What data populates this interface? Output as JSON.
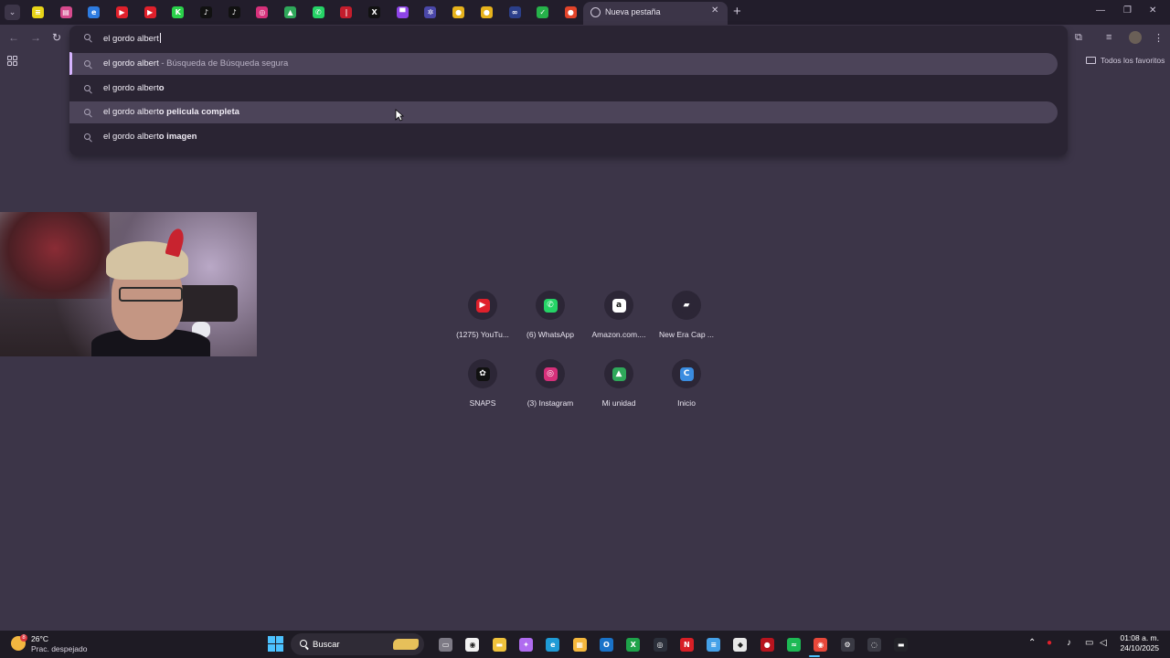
{
  "tabs": {
    "pinned": [
      {
        "name": "tab-pinned-1",
        "color": "#e8d418",
        "glyph": "≡"
      },
      {
        "name": "tab-pinned-2",
        "color": "#d64a8d",
        "glyph": "▤"
      },
      {
        "name": "tab-pinned-3",
        "color": "#2d7be0",
        "glyph": "e"
      },
      {
        "name": "tab-pinned-youtube-1",
        "color": "#e0202b",
        "glyph": "▶"
      },
      {
        "name": "tab-pinned-youtube-2",
        "color": "#e0202b",
        "glyph": "▶"
      },
      {
        "name": "tab-pinned-kick",
        "color": "#2ad14a",
        "glyph": "K"
      },
      {
        "name": "tab-pinned-tiktok-1",
        "color": "#111111",
        "glyph": "♪"
      },
      {
        "name": "tab-pinned-tiktok-2",
        "color": "#111111",
        "glyph": "♪"
      },
      {
        "name": "tab-pinned-instagram",
        "color": "#d6307a",
        "glyph": "◎"
      },
      {
        "name": "tab-pinned-drive",
        "color": "#2fa85a",
        "glyph": "▲"
      },
      {
        "name": "tab-pinned-whatsapp",
        "color": "#25d366",
        "glyph": "✆"
      },
      {
        "name": "tab-pinned-red",
        "color": "#c41d2c",
        "glyph": "|"
      },
      {
        "name": "tab-pinned-x",
        "color": "#111111",
        "glyph": "X"
      },
      {
        "name": "tab-pinned-twitch",
        "color": "#8e44e8",
        "glyph": "▀"
      },
      {
        "name": "tab-pinned-gear",
        "color": "#4a47a8",
        "glyph": "✲"
      },
      {
        "name": "tab-pinned-yellow-1",
        "color": "#e6b21c",
        "glyph": "●"
      },
      {
        "name": "tab-pinned-yellow-2",
        "color": "#e6b21c",
        "glyph": "●"
      },
      {
        "name": "tab-pinned-8",
        "color": "#2b3f8a",
        "glyph": "∞"
      },
      {
        "name": "tab-pinned-green",
        "color": "#26b24a",
        "glyph": "✓"
      },
      {
        "name": "tab-pinned-reddit",
        "color": "#e2442a",
        "glyph": "●"
      }
    ],
    "active_label": "Nueva pestaña"
  },
  "omnibox": {
    "query": "el gordo albert",
    "suggestions": [
      {
        "typed": "el gordo albert",
        "completion": "",
        "desc": " - Búsqueda de Búsqueda segura"
      },
      {
        "typed": "el gordo albert",
        "completion": "o",
        "desc": ""
      },
      {
        "typed": "el gordo albert",
        "completion": "o pelicula completa",
        "desc": ""
      },
      {
        "typed": "el gordo albert",
        "completion": "o imagen",
        "desc": ""
      }
    ]
  },
  "bookmarks": {
    "all_label": "Todos los favoritos"
  },
  "shortcuts": [
    {
      "label": "(1275) YouTu...",
      "color": "#e0202b",
      "glyph": "▶"
    },
    {
      "label": "(6) WhatsApp",
      "color": "#25d366",
      "glyph": "✆"
    },
    {
      "label": "Amazon.com....",
      "color": "#ffffff",
      "glyph": "a"
    },
    {
      "label": "New Era Cap ...",
      "color": "#2c2636",
      "glyph": "▰"
    },
    {
      "label": "SNAPS",
      "color": "#111111",
      "glyph": "✿"
    },
    {
      "label": "(3) Instagram",
      "color": "#d6307a",
      "glyph": "◎"
    },
    {
      "label": "Mi unidad",
      "color": "#2fa85a",
      "glyph": "▲"
    },
    {
      "label": "Inicio",
      "color": "#3a8ce0",
      "glyph": "C"
    }
  ],
  "taskbar": {
    "weather_temp": "26°C",
    "weather_cond": "Prac. despejado",
    "weather_badge": "8",
    "search_label": "Buscar",
    "apps": [
      {
        "name": "taskview",
        "color": "#7d7a85",
        "glyph": "▭"
      },
      {
        "name": "copilot",
        "color": "#f2f2f2",
        "glyph": "◉"
      },
      {
        "name": "explorer",
        "color": "#f0c33c",
        "glyph": "▬"
      },
      {
        "name": "copilot-app",
        "color": "#b06cf0",
        "glyph": "✦"
      },
      {
        "name": "edge",
        "color": "#1f9bd6",
        "glyph": "e"
      },
      {
        "name": "store",
        "color": "#f5b83d",
        "glyph": "▦"
      },
      {
        "name": "outlook",
        "color": "#1a73c9",
        "glyph": "O"
      },
      {
        "name": "xbox",
        "color": "#1ea34a",
        "glyph": "X"
      },
      {
        "name": "steam",
        "color": "#2b2f3a",
        "glyph": "◎"
      },
      {
        "name": "netflix",
        "color": "#d81f26",
        "glyph": "N"
      },
      {
        "name": "notes",
        "color": "#45a1e8",
        "glyph": "≡"
      },
      {
        "name": "roblox",
        "color": "#e8e8e8",
        "glyph": "◆"
      },
      {
        "name": "game-red",
        "color": "#b8141e",
        "glyph": "●"
      },
      {
        "name": "spotify",
        "color": "#1db954",
        "glyph": "≈"
      },
      {
        "name": "chrome",
        "color": "#e8483a",
        "glyph": "◉"
      },
      {
        "name": "settings",
        "color": "#3a3a44",
        "glyph": "⚙"
      },
      {
        "name": "obs",
        "color": "#3a3a44",
        "glyph": "◌"
      },
      {
        "name": "terminal",
        "color": "#222228",
        "glyph": "▬"
      }
    ],
    "time": "01:08 a. m.",
    "date": "24/10/2025"
  }
}
